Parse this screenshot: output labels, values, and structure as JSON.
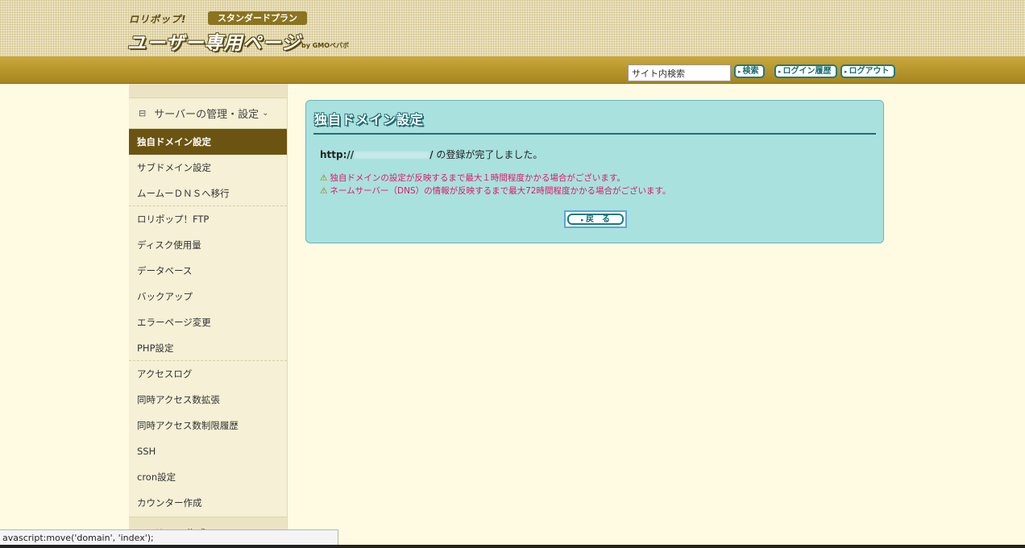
{
  "header": {
    "brand_small": "ロリポップ!",
    "plan_badge": "スタンダードプラン",
    "title": "ユーザー専用ページ",
    "by": "by GMOペパボ"
  },
  "toolbar": {
    "search_value": "サイト内検索",
    "search_button": "検索",
    "login_history_button": "ログイン履歴",
    "logout_button": "ログアウト"
  },
  "sidebar": {
    "section_title": "サーバーの管理・設定",
    "items": [
      {
        "label": "独自ドメイン設定"
      },
      {
        "label": "サブドメイン設定"
      },
      {
        "label": "ムームーＤＮＳへ移行"
      },
      {
        "label": "ロリポップ！FTP"
      },
      {
        "label": "ディスク使用量"
      },
      {
        "label": "データベース"
      },
      {
        "label": "バックアップ"
      },
      {
        "label": "エラーページ変更"
      },
      {
        "label": "PHP設定"
      },
      {
        "label": "アクセスログ"
      },
      {
        "label": "同時アクセス数拡張"
      },
      {
        "label": "同時アクセス数制限履歴"
      },
      {
        "label": "SSH"
      },
      {
        "label": "cron設定"
      },
      {
        "label": "カウンター作成"
      }
    ],
    "bottom_section_title": "サイト作成ツール"
  },
  "panel": {
    "title": "独自ドメイン設定",
    "url_prefix": "http://",
    "url_suffix": "/",
    "message": " の登録が完了しました。",
    "warnings": [
      "独自ドメインの設定が反映するまで最大１時間程度かかる場合がございます。",
      "ネームサーバー（DNS）の情報が反映するまで最大72時間程度かかる場合がございます。"
    ],
    "back_button": "戻　る"
  },
  "statusbar": {
    "text": "avascript:move('domain', 'index');"
  }
}
